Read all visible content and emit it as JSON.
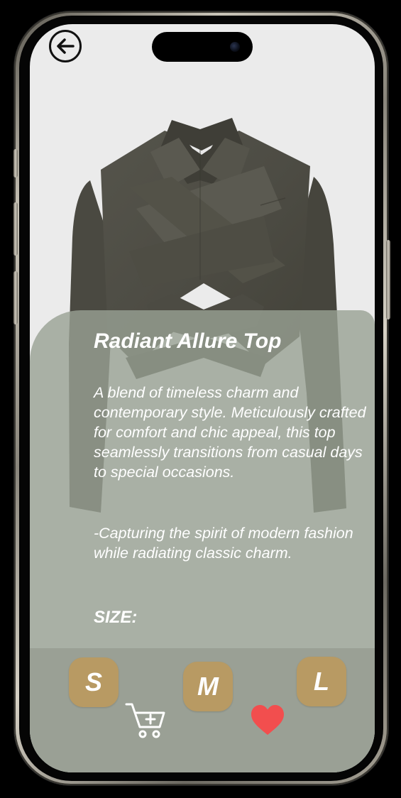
{
  "header": {
    "back_icon": "arrow-left-circle-icon"
  },
  "product": {
    "title": "Radiant Allure Top",
    "description_1": "A blend of timeless charm and contemporary style. Meticulously crafted for comfort and chic appeal, this top seamlessly transitions from casual days to special occasions.",
    "description_2": "-Capturing the spirit of modern fashion while radiating classic charm.",
    "size_label": "SIZE:",
    "image_icon": "cropped-wrap-blazer-image"
  },
  "sizes": [
    {
      "label": "S"
    },
    {
      "label": "M"
    },
    {
      "label": "L"
    }
  ],
  "actions": {
    "cart_icon": "add-to-cart-icon",
    "favorite_icon": "heart-icon"
  },
  "colors": {
    "panel": "#98a194",
    "size_button": "#b89a63",
    "heart": "#f24e4e",
    "garment": "#4f4e46"
  }
}
